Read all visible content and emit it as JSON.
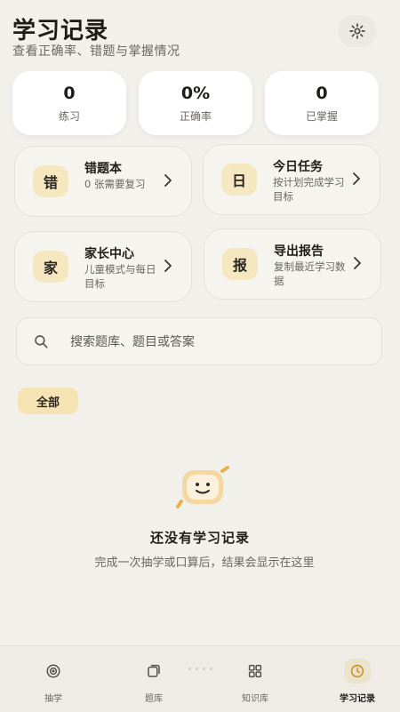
{
  "header": {
    "title": "学习记录",
    "subtitle": "查看正确率、错题与掌握情况",
    "settings_icon": "gear-icon"
  },
  "stats": [
    {
      "value": "0",
      "label": "练习"
    },
    {
      "value": "0%",
      "label": "正确率"
    },
    {
      "value": "0",
      "label": "已掌握"
    }
  ],
  "features": [
    {
      "badge": "错",
      "title": "错题本",
      "desc": "0 张需要复习"
    },
    {
      "badge": "日",
      "title": "今日任务",
      "desc": "按计划完成学习目标"
    },
    {
      "badge": "家",
      "title": "家长中心",
      "desc": "儿童模式与每日目标"
    },
    {
      "badge": "报",
      "title": "导出报告",
      "desc": "复制最近学习数据"
    }
  ],
  "search": {
    "placeholder": "搜索题库、题目或答案",
    "value": "",
    "icon": "search-icon"
  },
  "filter": {
    "chip_label": "全部"
  },
  "empty_state": {
    "icon": "smile-card-icon",
    "title": "还没有学习记录",
    "description": "完成一次抽学或口算后，结果会显示在这里"
  },
  "bottom_nav": [
    {
      "label": "抽学",
      "icon": "target-icon",
      "active": false
    },
    {
      "label": "题库",
      "icon": "cards-icon",
      "active": false
    },
    {
      "label": "知识库",
      "icon": "grid-icon",
      "active": false
    },
    {
      "label": "学习记录",
      "icon": "clock-icon",
      "active": true
    }
  ],
  "colors": {
    "background": "#f2f0eb",
    "accent": "#f5e3b3",
    "badge": "#f5e7bf",
    "text": "#1f1c19",
    "muted": "#6b6760"
  }
}
